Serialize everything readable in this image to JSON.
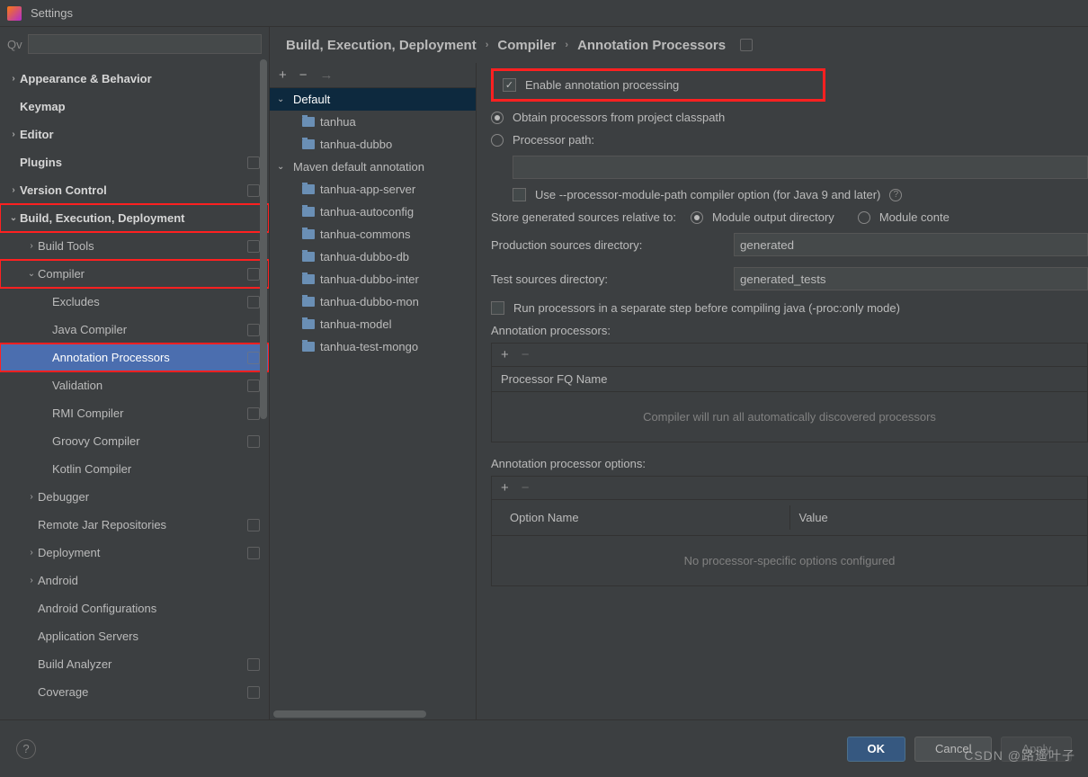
{
  "window": {
    "title": "Settings"
  },
  "breadcrumb": {
    "a": "Build, Execution, Deployment",
    "b": "Compiler",
    "c": "Annotation Processors"
  },
  "sidebar": {
    "items": [
      {
        "label": "Appearance & Behavior",
        "lv": 0,
        "arrow": "›",
        "bold": true
      },
      {
        "label": "Keymap",
        "lv": 0,
        "bold": true
      },
      {
        "label": "Editor",
        "lv": 0,
        "arrow": "›",
        "bold": true
      },
      {
        "label": "Plugins",
        "lv": 0,
        "bold": true,
        "badge": true
      },
      {
        "label": "Version Control",
        "lv": 0,
        "arrow": "›",
        "bold": true,
        "badge": true
      },
      {
        "label": "Build, Execution, Deployment",
        "lv": 0,
        "arrow": "⌄",
        "bold": true,
        "red": true
      },
      {
        "label": "Build Tools",
        "lv": 1,
        "arrow": "›",
        "badge": true
      },
      {
        "label": "Compiler",
        "lv": 1,
        "arrow": "⌄",
        "badge": true,
        "red": true
      },
      {
        "label": "Excludes",
        "lv": 2,
        "badge": true
      },
      {
        "label": "Java Compiler",
        "lv": 2,
        "badge": true
      },
      {
        "label": "Annotation Processors",
        "lv": 2,
        "badge": true,
        "red": true,
        "selected": true
      },
      {
        "label": "Validation",
        "lv": 2,
        "badge": true
      },
      {
        "label": "RMI Compiler",
        "lv": 2,
        "badge": true
      },
      {
        "label": "Groovy Compiler",
        "lv": 2,
        "badge": true
      },
      {
        "label": "Kotlin Compiler",
        "lv": 2
      },
      {
        "label": "Debugger",
        "lv": 1,
        "arrow": "›"
      },
      {
        "label": "Remote Jar Repositories",
        "lv": 1,
        "badge": true
      },
      {
        "label": "Deployment",
        "lv": 1,
        "arrow": "›",
        "badge": true
      },
      {
        "label": "Android",
        "lv": 1,
        "arrow": "›"
      },
      {
        "label": "Android Configurations",
        "lv": 1
      },
      {
        "label": "Application Servers",
        "lv": 1
      },
      {
        "label": "Build Analyzer",
        "lv": 1,
        "badge": true
      },
      {
        "label": "Coverage",
        "lv": 1,
        "badge": true
      }
    ]
  },
  "profiles": {
    "items": [
      {
        "label": "Default",
        "lv": 0,
        "arrow": "⌄",
        "sel": true
      },
      {
        "label": "tanhua",
        "lv": 1,
        "folder": true
      },
      {
        "label": "tanhua-dubbo",
        "lv": 1,
        "folder": true
      },
      {
        "label": "Maven default annotation",
        "lv": 0,
        "arrow": "⌄"
      },
      {
        "label": "tanhua-app-server",
        "lv": 1,
        "folder": true
      },
      {
        "label": "tanhua-autoconfig",
        "lv": 1,
        "folder": true
      },
      {
        "label": "tanhua-commons",
        "lv": 1,
        "folder": true
      },
      {
        "label": "tanhua-dubbo-db",
        "lv": 1,
        "folder": true
      },
      {
        "label": "tanhua-dubbo-inter",
        "lv": 1,
        "folder": true
      },
      {
        "label": "tanhua-dubbo-mon",
        "lv": 1,
        "folder": true
      },
      {
        "label": "tanhua-model",
        "lv": 1,
        "folder": true
      },
      {
        "label": "tanhua-test-mongo",
        "lv": 1,
        "folder": true
      }
    ]
  },
  "details": {
    "enable_label": "Enable annotation processing",
    "obtain_label": "Obtain processors from project classpath",
    "procpath_label": "Processor path:",
    "modulepath_label": "Use --processor-module-path compiler option (for Java 9 and later)",
    "store_label": "Store generated sources relative to:",
    "store_opt1": "Module output directory",
    "store_opt2": "Module conte",
    "prod_label": "Production sources directory:",
    "prod_value": "generated",
    "test_label": "Test sources directory:",
    "test_value": "generated_tests",
    "separate_label": "Run processors in a separate step before compiling java (-proc:only mode)",
    "ap_title": "Annotation processors:",
    "ap_header": "Processor FQ Name",
    "ap_empty": "Compiler will run all automatically discovered processors",
    "opt_title": "Annotation processor options:",
    "opt_col1": "Option Name",
    "opt_col2": "Value",
    "opt_empty": "No processor-specific options configured"
  },
  "footer": {
    "ok": "OK",
    "cancel": "Cancel",
    "apply": "Apply"
  },
  "watermark": "CSDN @路遥叶子"
}
